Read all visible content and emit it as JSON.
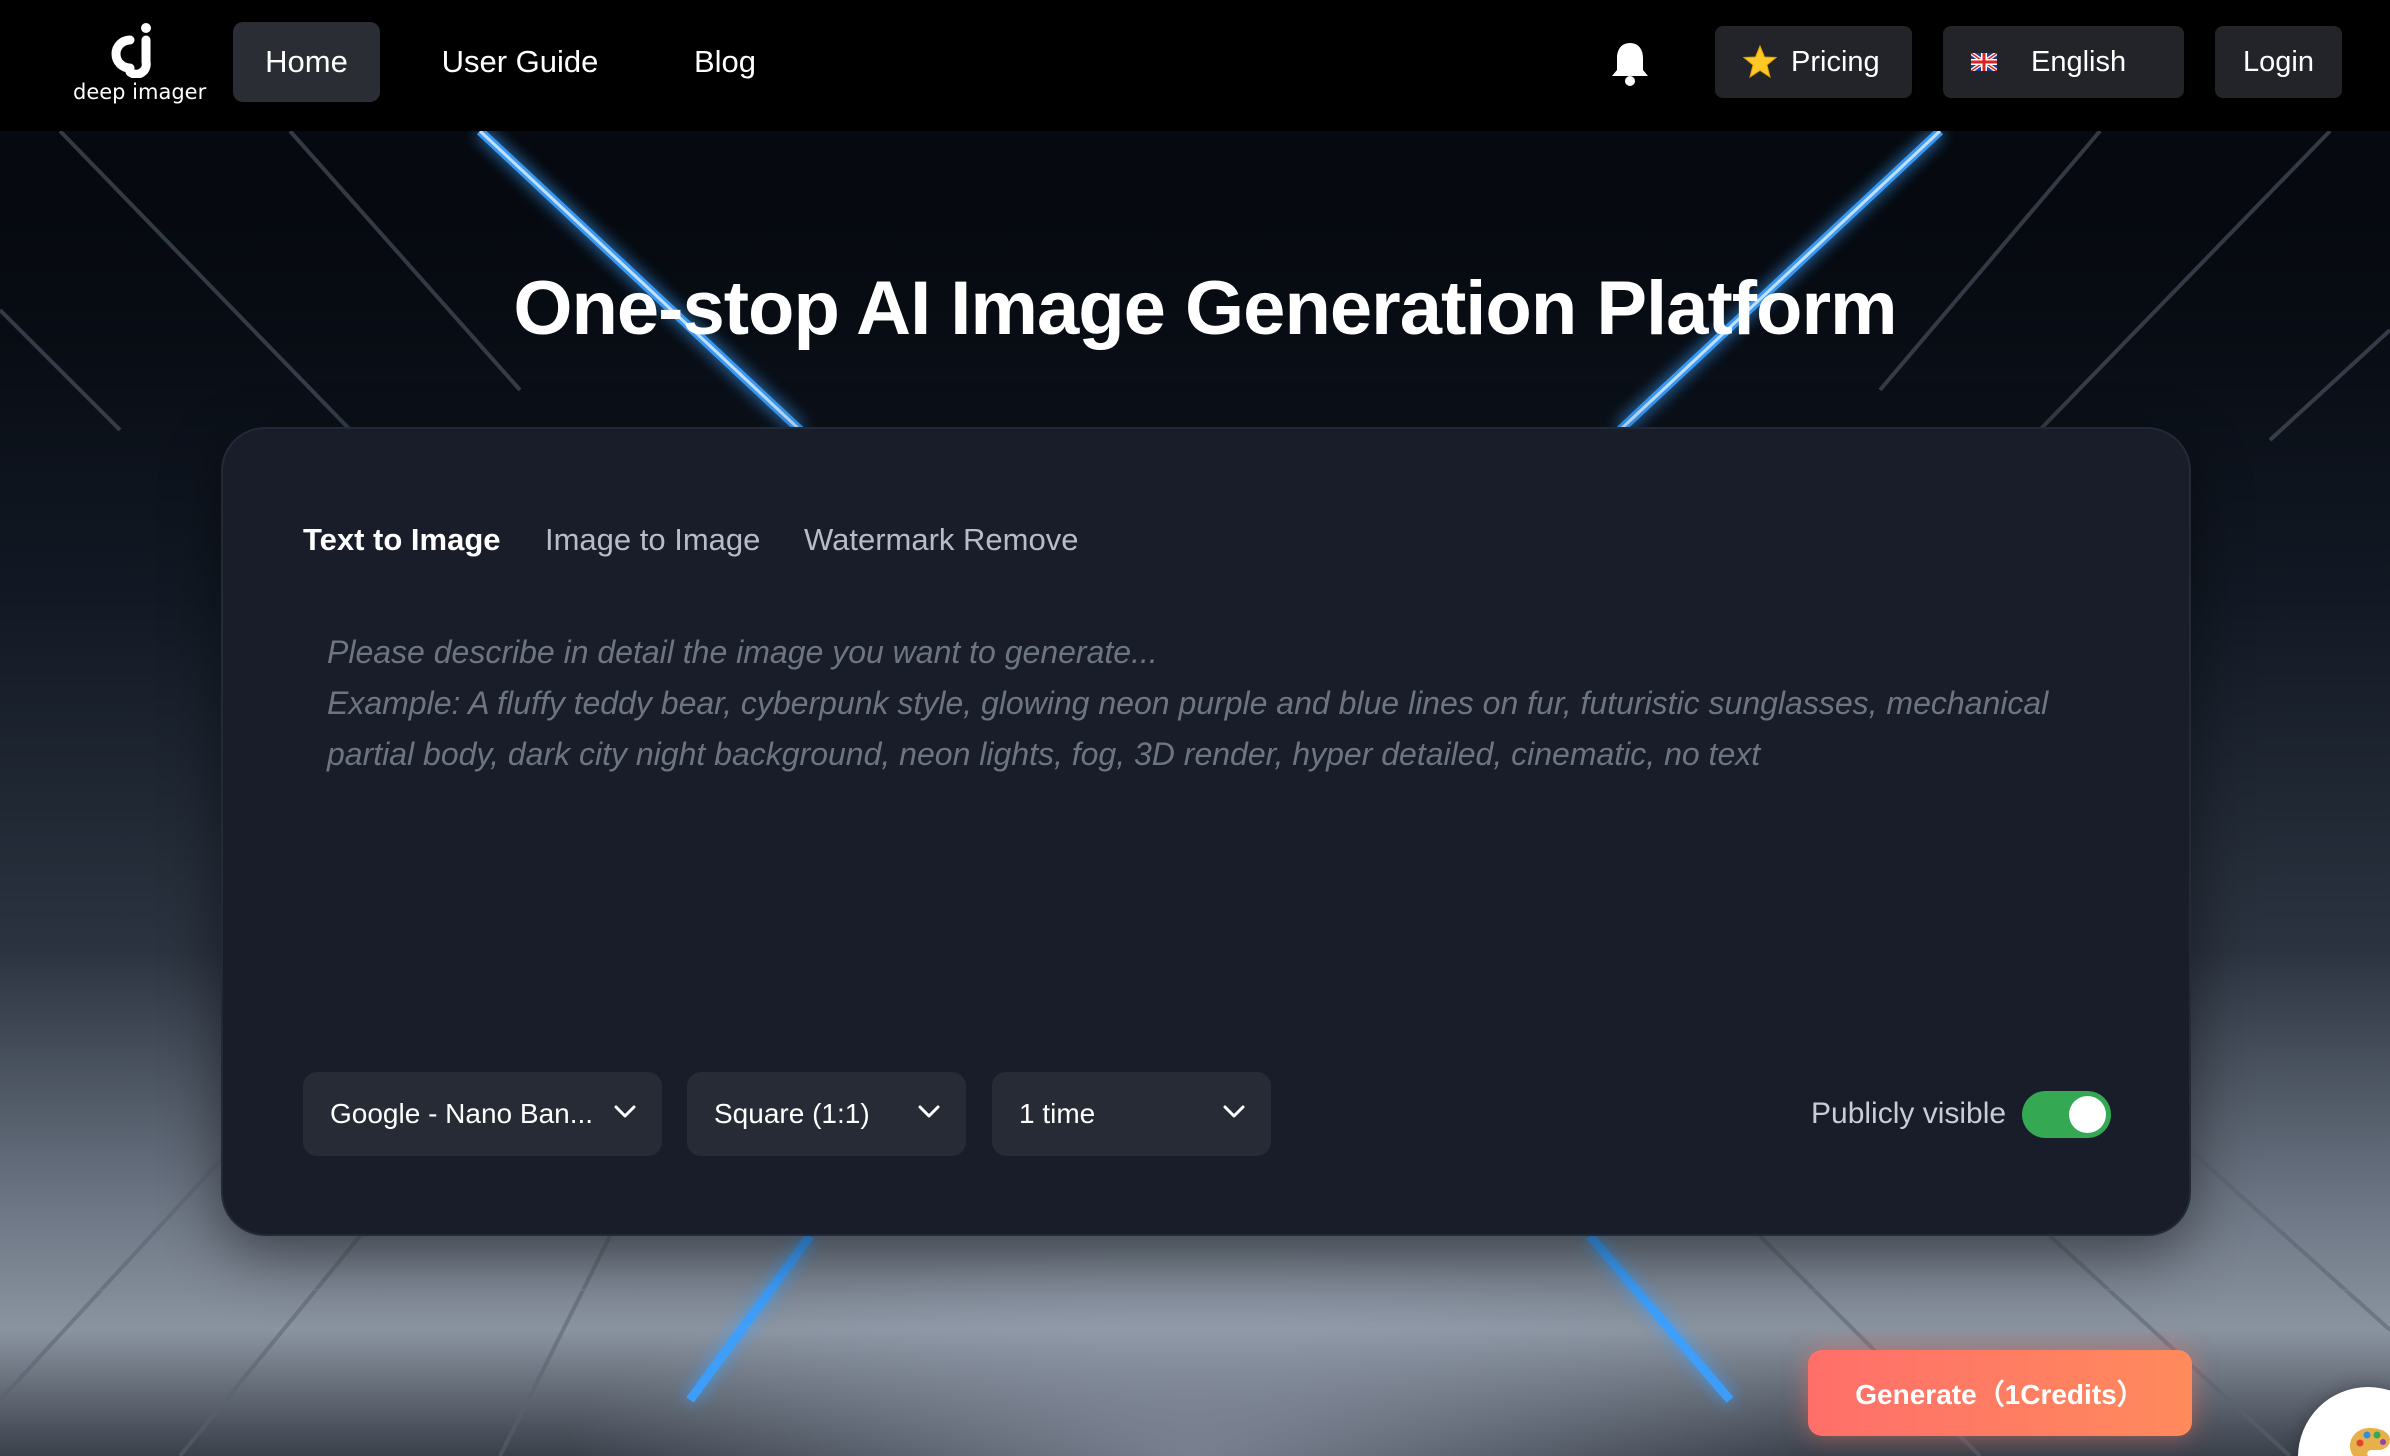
{
  "brand": {
    "logo_text": "deep imager"
  },
  "nav": {
    "home": "Home",
    "user_guide": "User Guide",
    "blog": "Blog",
    "pricing": "Pricing",
    "language": "English",
    "login": "Login"
  },
  "icons": {
    "notifications": "bell-icon",
    "pricing": "star-icon",
    "language": "uk-flag-icon",
    "dropdown": "chevron-down-icon",
    "corner_widget": "palette-icon"
  },
  "hero": {
    "title": "One-stop AI Image Generation Platform"
  },
  "tabs": [
    {
      "label": "Text to Image",
      "active": true
    },
    {
      "label": "Image to Image",
      "active": false
    },
    {
      "label": "Watermark Remove",
      "active": false
    }
  ],
  "prompt": {
    "value": "",
    "placeholder": "Please describe in detail the image you want to generate...\nExample: A fluffy teddy bear, cyberpunk style, glowing neon purple and blue lines on fur, futuristic sunglasses, mechanical partial body, dark city night background, neon lights, fog, 3D render, hyper detailed, cinematic, no text"
  },
  "options": {
    "model": "Google - Nano Ban...",
    "aspect_ratio": "Square (1:1)",
    "count": "1 time"
  },
  "visibility": {
    "label": "Publicly visible",
    "enabled": true
  },
  "generate": {
    "label": "Generate（1Credits）"
  },
  "colors": {
    "accent_generate": "#ff7466",
    "toggle_on": "#34a853",
    "card_bg": "#181d29",
    "nav_bg": "#000000",
    "neon_blue": "#3aa0ff"
  }
}
